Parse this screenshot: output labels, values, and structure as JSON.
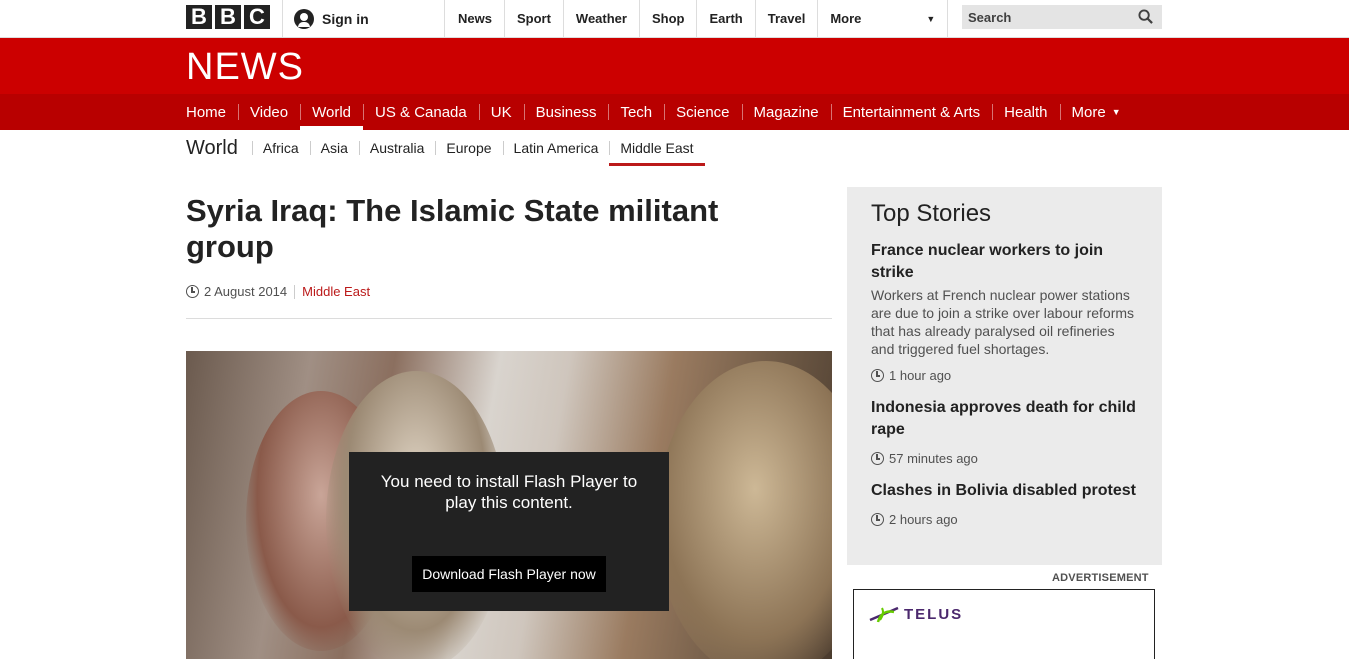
{
  "topbar": {
    "logo_letters": [
      "B",
      "B",
      "C"
    ],
    "signin_label": "Sign in",
    "nav": [
      "News",
      "Sport",
      "Weather",
      "Shop",
      "Earth",
      "Travel"
    ],
    "more_label": "More",
    "search_placeholder": "Search"
  },
  "brand": {
    "news_logo": "NEWS"
  },
  "section_nav": {
    "items": [
      "Home",
      "Video",
      "World",
      "US & Canada",
      "UK",
      "Business",
      "Tech",
      "Science",
      "Magazine",
      "Entertainment & Arts",
      "Health",
      "More"
    ],
    "active": "World"
  },
  "sub_nav": {
    "title": "World",
    "items": [
      "Africa",
      "Asia",
      "Australia",
      "Europe",
      "Latin America",
      "Middle East"
    ],
    "active": "Middle East"
  },
  "article": {
    "headline": "Syria Iraq: The Islamic State militant group",
    "date": "2 August 2014",
    "section": "Middle East",
    "flash_message": "You need to install Flash Player to play this content.",
    "flash_button": "Download Flash Player now"
  },
  "top_stories": {
    "heading": "Top Stories",
    "stories": [
      {
        "title": "France nuclear workers to join strike",
        "summary": "Workers at French nuclear power stations are due to join a strike over labour reforms that has already paralysed oil refineries and triggered fuel shortages.",
        "time": "1 hour ago"
      },
      {
        "title": "Indonesia approves death for child rape",
        "summary": "",
        "time": "57 minutes ago"
      },
      {
        "title": "Clashes in Bolivia disabled protest",
        "summary": "",
        "time": "2 hours ago"
      }
    ]
  },
  "advertisement": {
    "label": "ADVERTISEMENT",
    "brand": "TELUS"
  },
  "colors": {
    "brand_red": "#cc0000",
    "section_red": "#b80000",
    "link_red": "#bb1919",
    "telus_purple": "#4b286d"
  }
}
